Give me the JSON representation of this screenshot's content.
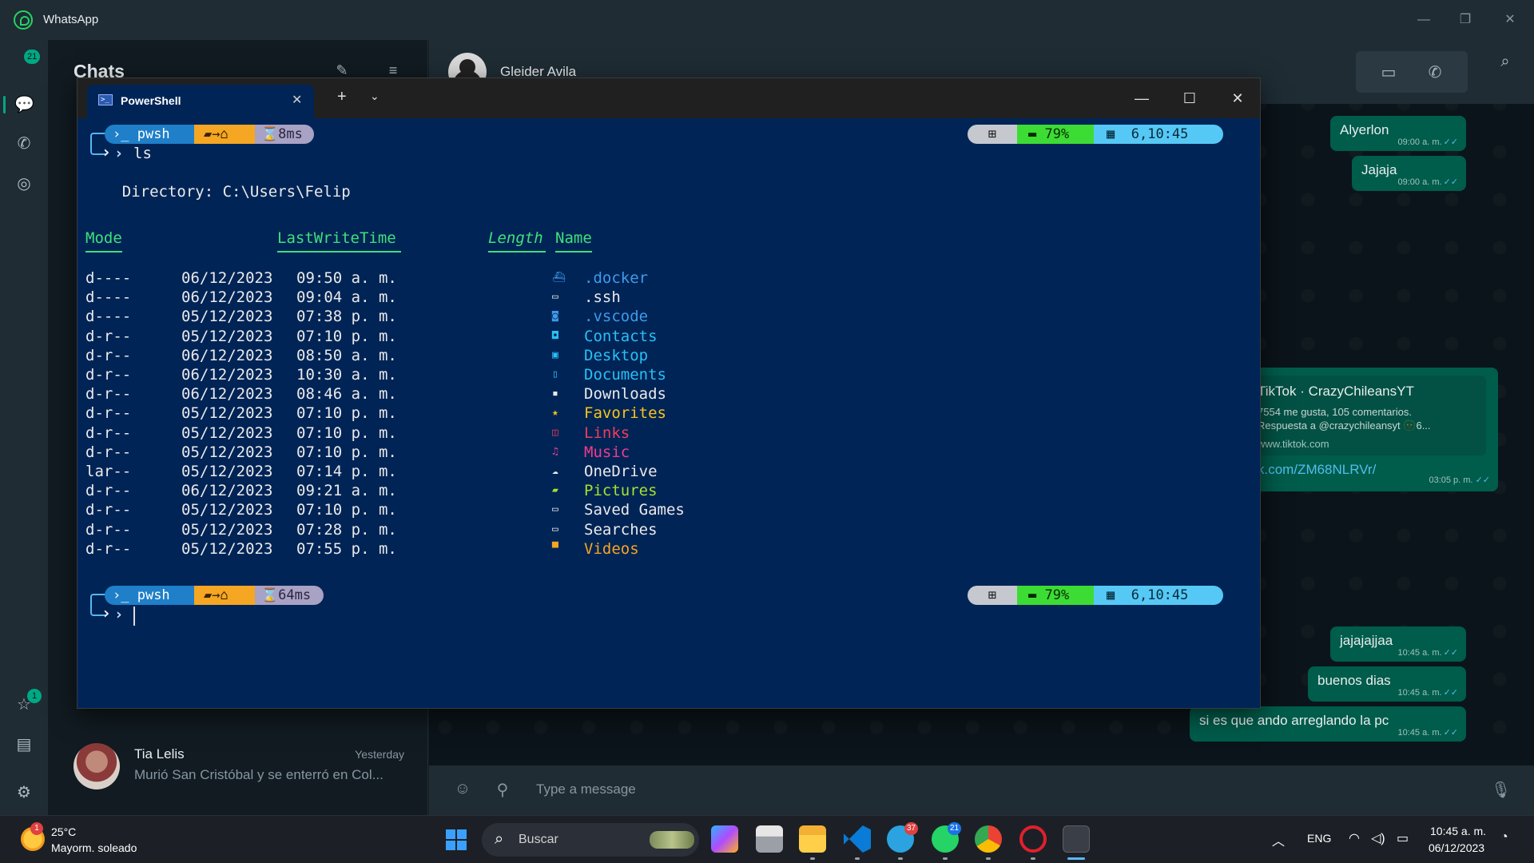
{
  "whatsapp": {
    "app_title": "WhatsApp",
    "rail": {
      "chats_badge": "21",
      "archive_badge": "1"
    },
    "chats_title": "Chats",
    "chat_item": {
      "name": "Tia Lelis",
      "time": "Yesterday",
      "preview": "Murió San Cristóbal y se enterró en Col..."
    },
    "conversation": {
      "contact_name": "Gleider Avila",
      "messages": [
        {
          "text": "Alyerlon",
          "time": "09:00 a. m."
        },
        {
          "text": "Jajaja",
          "time": "09:00 a. m."
        },
        {
          "text": "jajajajjaa",
          "time": "10:45 a. m."
        },
        {
          "text": "buenos dias",
          "time": "10:45 a. m."
        },
        {
          "text": "si es que ando arreglando la pc",
          "time": "10:45 a. m."
        }
      ],
      "link_preview": {
        "title": "TikTok · CrazyChileansYT",
        "desc1": "7554 me gusta, 105 comentarios.",
        "desc2": "Respuesta a @crazychileansyt 🫥6...",
        "domain": "www.tiktok.com",
        "url": "k.com/ZM68NLRVr/",
        "time": "03:05 p. m."
      },
      "ticks": "✓✓",
      "composer_placeholder": "Type a message"
    }
  },
  "terminal": {
    "tab_label": "PowerShell",
    "prompt1": {
      "shell": "pwsh",
      "path_icons": "▰→⌂",
      "duration": "⌛8ms",
      "command": "ls"
    },
    "prompt2": {
      "shell": "pwsh",
      "path_icons": "▰→⌂",
      "duration": "⌛64ms"
    },
    "status": {
      "os_icon": "⊞",
      "battery": "79%",
      "battery_icon": "▬",
      "calendar_icon": "▦",
      "time": "6,10:45"
    },
    "directory_line": "    Directory: C:\\Users\\Felip",
    "headers": {
      "mode": "Mode",
      "lastwrite": "LastWriteTime",
      "length": "Length",
      "name": "Name"
    },
    "rows": [
      {
        "mode": "d----",
        "date": "06/12/2023",
        "time": "09:50 a. m.",
        "icon": "⛴",
        "name": ".docker",
        "color": "#3d9bea"
      },
      {
        "mode": "d----",
        "date": "06/12/2023",
        "time": "09:04 a. m.",
        "icon": "▭",
        "name": ".ssh",
        "color": "#eaeaea"
      },
      {
        "mode": "d----",
        "date": "05/12/2023",
        "time": "07:38 p. m.",
        "icon": "◙",
        "name": ".vscode",
        "color": "#3d9bea"
      },
      {
        "mode": "d-r--",
        "date": "05/12/2023",
        "time": "07:10 p. m.",
        "icon": "◘",
        "name": "Contacts",
        "color": "#29c0f5"
      },
      {
        "mode": "d-r--",
        "date": "06/12/2023",
        "time": "08:50 a. m.",
        "icon": "▣",
        "name": "Desktop",
        "color": "#29c0f5"
      },
      {
        "mode": "d-r--",
        "date": "06/12/2023",
        "time": "10:30 a. m.",
        "icon": "▯",
        "name": "Documents",
        "color": "#29c0f5"
      },
      {
        "mode": "d-r--",
        "date": "06/12/2023",
        "time": "08:46 a. m.",
        "icon": "▪",
        "name": "Downloads",
        "color": "#eaeaea"
      },
      {
        "mode": "d-r--",
        "date": "05/12/2023",
        "time": "07:10 p. m.",
        "icon": "★",
        "name": "Favorites",
        "color": "#f5c518"
      },
      {
        "mode": "d-r--",
        "date": "05/12/2023",
        "time": "07:10 p. m.",
        "icon": "◫",
        "name": "Links",
        "color": "#f03c5c"
      },
      {
        "mode": "d-r--",
        "date": "05/12/2023",
        "time": "07:10 p. m.",
        "icon": "♫",
        "name": "Music",
        "color": "#f03c8c"
      },
      {
        "mode": "lar--",
        "date": "05/12/2023",
        "time": "07:14 p. m.",
        "icon": "☁",
        "name": "OneDrive",
        "color": "#eaeaea"
      },
      {
        "mode": "d-r--",
        "date": "06/12/2023",
        "time": "09:21 a. m.",
        "icon": "▰",
        "name": "Pictures",
        "color": "#a6e22e"
      },
      {
        "mode": "d-r--",
        "date": "05/12/2023",
        "time": "07:10 p. m.",
        "icon": "▭",
        "name": "Saved Games",
        "color": "#eaeaea"
      },
      {
        "mode": "d-r--",
        "date": "05/12/2023",
        "time": "07:28 p. m.",
        "icon": "▭",
        "name": "Searches",
        "color": "#eaeaea"
      },
      {
        "mode": "d-r--",
        "date": "05/12/2023",
        "time": "07:55 p. m.",
        "icon": "▀",
        "name": "Videos",
        "color": "#f5a623"
      }
    ]
  },
  "taskbar": {
    "weather_badge": "1",
    "temperature": "25°C",
    "weather_desc": "Mayorm. soleado",
    "search_label": "Buscar",
    "telegram_badge": "37",
    "whatsapp_badge": "21",
    "language": "ENG",
    "time": "10:45 a. m.",
    "date": "06/12/2023"
  },
  "colors": {
    "terminal_bg": "#012456",
    "wa_bubble": "#005c4b",
    "prompt_shell": "#1f7fc8",
    "prompt_path": "#f5a623",
    "prompt_time": "#a8a2c4",
    "status_os": "#c5c9cf",
    "status_battery": "#3ddc34",
    "status_clock": "#56c8f5"
  }
}
